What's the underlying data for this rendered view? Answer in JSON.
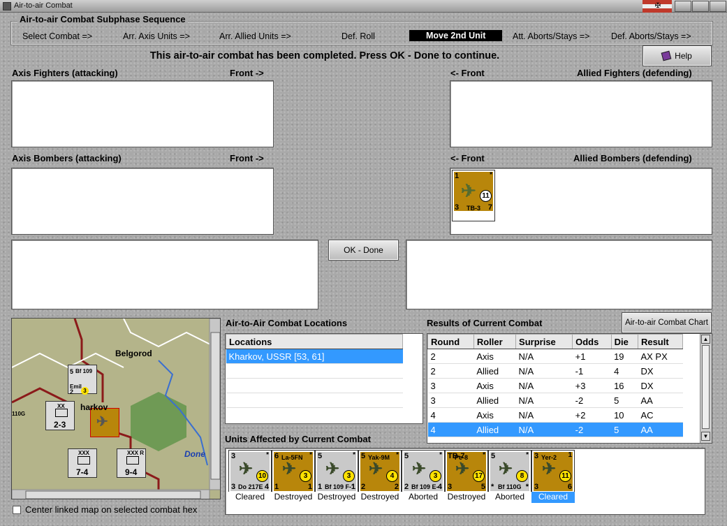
{
  "window": {
    "title": "Air-to-air Combat"
  },
  "sequence": {
    "legend": "Air-to-air Combat Subphase Sequence",
    "steps": [
      "Select Combat =>",
      "Arr. Axis Units =>",
      "Arr. Allied Units =>",
      "Def. Roll",
      "Move 2nd Unit",
      "Att. Aborts/Stays =>",
      "Def. Aborts/Stays =>"
    ],
    "active_step": "Move 2nd Unit"
  },
  "headline": "This air-to-air combat has been completed.  Press OK - Done to continue.",
  "help_label": "Help",
  "panels": {
    "axis_fighters": "Axis Fighters (attacking)",
    "axis_bombers": "Axis Bombers (attacking)",
    "allied_fighters": "Allied Fighters (defending)",
    "allied_bombers": "Allied Bombers (defending)",
    "front_right": "Front ->",
    "front_left": "<- Front"
  },
  "allied_bomber_counter": {
    "tl": "1",
    "tr": "*",
    "bl": "3",
    "br": "7",
    "name": "TB-3",
    "circle": "11"
  },
  "ok_done_label": "OK - Done",
  "map": {
    "city": "Belgorod",
    "done_label": "Done",
    "counters": [
      {
        "label": "Bf 109",
        "sub": "Emil",
        "tl": "5",
        "bl": "2",
        "circle": "3"
      },
      {
        "label": "XX",
        "value": "2-3",
        "side": "Xnd Inf"
      },
      {
        "label": "XXX",
        "value": "7-4"
      },
      {
        "label": "XXX",
        "value": "9-4",
        "tr": "R"
      }
    ],
    "partial_label": "110G",
    "partial_city": "harkov"
  },
  "center_map_label": "Center linked map on selected combat hex",
  "locations": {
    "title": "Air-to-Air Combat Locations",
    "header": "Locations",
    "rows": [
      "Kharkov, USSR [53, 61]"
    ]
  },
  "results": {
    "title": "Results of Current Combat",
    "chart_button": "Air-to-air Combat Chart",
    "columns": [
      "Round",
      "Roller",
      "Surprise",
      "Odds",
      "Die",
      "Result"
    ],
    "rows": [
      [
        "2",
        "Axis",
        "N/A",
        "+1",
        "19",
        "AX PX"
      ],
      [
        "2",
        "Allied",
        "N/A",
        "-1",
        "4",
        "DX"
      ],
      [
        "3",
        "Axis",
        "N/A",
        "+3",
        "16",
        "DX"
      ],
      [
        "3",
        "Allied",
        "N/A",
        "-2",
        "5",
        "AA"
      ],
      [
        "4",
        "Axis",
        "N/A",
        "+2",
        "10",
        "AC"
      ],
      [
        "4",
        "Allied",
        "N/A",
        "-2",
        "5",
        "AA"
      ]
    ],
    "selected_row": 5
  },
  "units": {
    "title": "Units Affected by Current Combat",
    "items": [
      {
        "name": "Do 217E",
        "tl": "3",
        "tr": "*",
        "bl": "3",
        "br": "4",
        "circle": "10",
        "status": "Cleared",
        "side": "axis"
      },
      {
        "name": "La-5FN",
        "tl": "6",
        "tr": "*",
        "bl": "1",
        "br": "1",
        "circle": "3",
        "status": "Destroyed",
        "side": "allied"
      },
      {
        "name": "Bf 109 F-1",
        "tl": "5",
        "tr": "*",
        "bl": "1",
        "br": "1",
        "circle": "3",
        "status": "Destroyed",
        "side": "axis"
      },
      {
        "name": "Yak-9M",
        "tl": "5",
        "tr": "*",
        "bl": "2",
        "br": "2",
        "circle": "4",
        "status": "Destroyed",
        "side": "allied"
      },
      {
        "name": "Bf 109 E-4 Emil",
        "tl": "5",
        "tr": "*",
        "bl": "2",
        "br": "4",
        "circle": "3",
        "status": "Aborted",
        "side": "axis"
      },
      {
        "name": "Pe-8",
        "tl": "TB-7",
        "tr": "*",
        "bl": "3",
        "br": "5",
        "circle": "17",
        "status": "Destroyed",
        "side": "allied"
      },
      {
        "name": "Bf 110G",
        "tl": "5",
        "tr": "*",
        "bl": "*",
        "br": "*",
        "circle": "8",
        "status": "Aborted",
        "side": "axis"
      },
      {
        "name": "Yer-2",
        "tl": "3",
        "tr": "1",
        "bl": "3",
        "br": "6",
        "circle": "11",
        "status": "Cleared",
        "side": "allied"
      }
    ],
    "selected_index": 7
  },
  "colors": {
    "allied": "#b8860b",
    "axis": "#c9c9c9",
    "selection": "#3399ff"
  }
}
